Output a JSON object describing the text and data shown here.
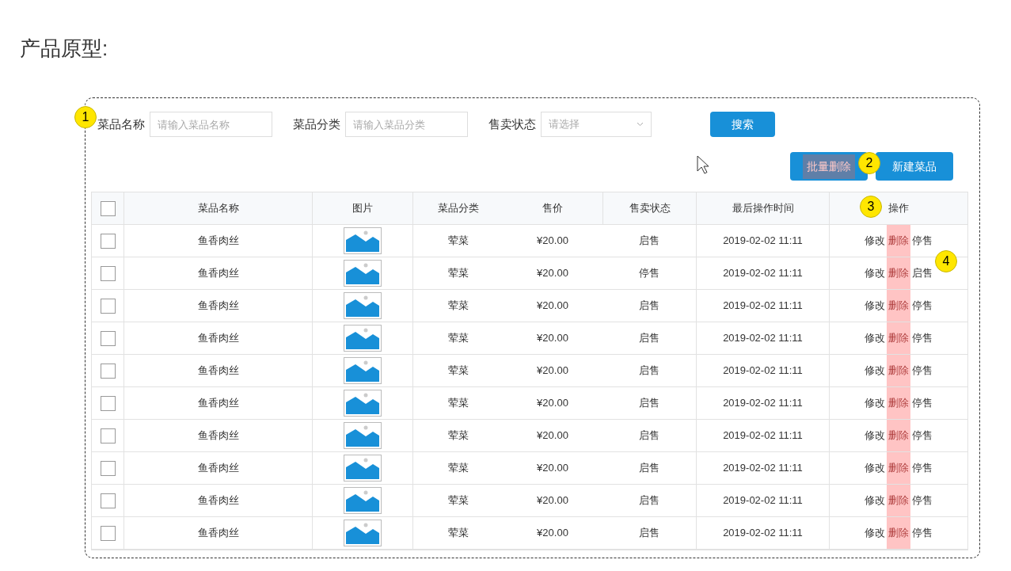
{
  "heading": "产品原型:",
  "filters": [
    {
      "kind": "text",
      "label": "菜品名称",
      "placeholder": "请输入菜品名称"
    },
    {
      "kind": "text",
      "label": "菜品分类",
      "placeholder": "请输入菜品分类"
    },
    {
      "kind": "select",
      "label": "售卖状态",
      "placeholder": "请选择"
    }
  ],
  "search_button": "搜索",
  "actions": [
    {
      "label": "批量删除",
      "highlighted": true
    },
    {
      "label": "新建菜品",
      "highlighted": false
    }
  ],
  "markers": [
    "1",
    "2",
    "3",
    "4"
  ],
  "table": {
    "header_checked": false,
    "columns": [
      "菜品名称",
      "图片",
      "菜品分类",
      "售价",
      "售卖状态",
      "最后操作时间",
      "操作"
    ],
    "rows": [
      {
        "checked": false,
        "name": "鱼香肉丝",
        "category": "荤菜",
        "price": "¥20.00",
        "status": "启售",
        "time": "2019-02-02 11:11",
        "ops": [
          "修改",
          "删除",
          "停售"
        ]
      },
      {
        "checked": false,
        "name": "鱼香肉丝",
        "category": "荤菜",
        "price": "¥20.00",
        "status": "停售",
        "time": "2019-02-02 11:11",
        "ops": [
          "修改",
          "删除",
          "启售"
        ]
      },
      {
        "checked": false,
        "name": "鱼香肉丝",
        "category": "荤菜",
        "price": "¥20.00",
        "status": "启售",
        "time": "2019-02-02 11:11",
        "ops": [
          "修改",
          "删除",
          "停售"
        ]
      },
      {
        "checked": false,
        "name": "鱼香肉丝",
        "category": "荤菜",
        "price": "¥20.00",
        "status": "启售",
        "time": "2019-02-02 11:11",
        "ops": [
          "修改",
          "删除",
          "停售"
        ]
      },
      {
        "checked": false,
        "name": "鱼香肉丝",
        "category": "荤菜",
        "price": "¥20.00",
        "status": "启售",
        "time": "2019-02-02 11:11",
        "ops": [
          "修改",
          "删除",
          "停售"
        ]
      },
      {
        "checked": false,
        "name": "鱼香肉丝",
        "category": "荤菜",
        "price": "¥20.00",
        "status": "启售",
        "time": "2019-02-02 11:11",
        "ops": [
          "修改",
          "删除",
          "停售"
        ]
      },
      {
        "checked": false,
        "name": "鱼香肉丝",
        "category": "荤菜",
        "price": "¥20.00",
        "status": "启售",
        "time": "2019-02-02 11:11",
        "ops": [
          "修改",
          "删除",
          "停售"
        ]
      },
      {
        "checked": false,
        "name": "鱼香肉丝",
        "category": "荤菜",
        "price": "¥20.00",
        "status": "启售",
        "time": "2019-02-02 11:11",
        "ops": [
          "修改",
          "删除",
          "停售"
        ]
      },
      {
        "checked": false,
        "name": "鱼香肉丝",
        "category": "荤菜",
        "price": "¥20.00",
        "status": "启售",
        "time": "2019-02-02 11:11",
        "ops": [
          "修改",
          "删除",
          "停售"
        ]
      },
      {
        "checked": false,
        "name": "鱼香肉丝",
        "category": "荤菜",
        "price": "¥20.00",
        "status": "启售",
        "time": "2019-02-02 11:11",
        "ops": [
          "修改",
          "删除",
          "停售"
        ]
      }
    ]
  }
}
